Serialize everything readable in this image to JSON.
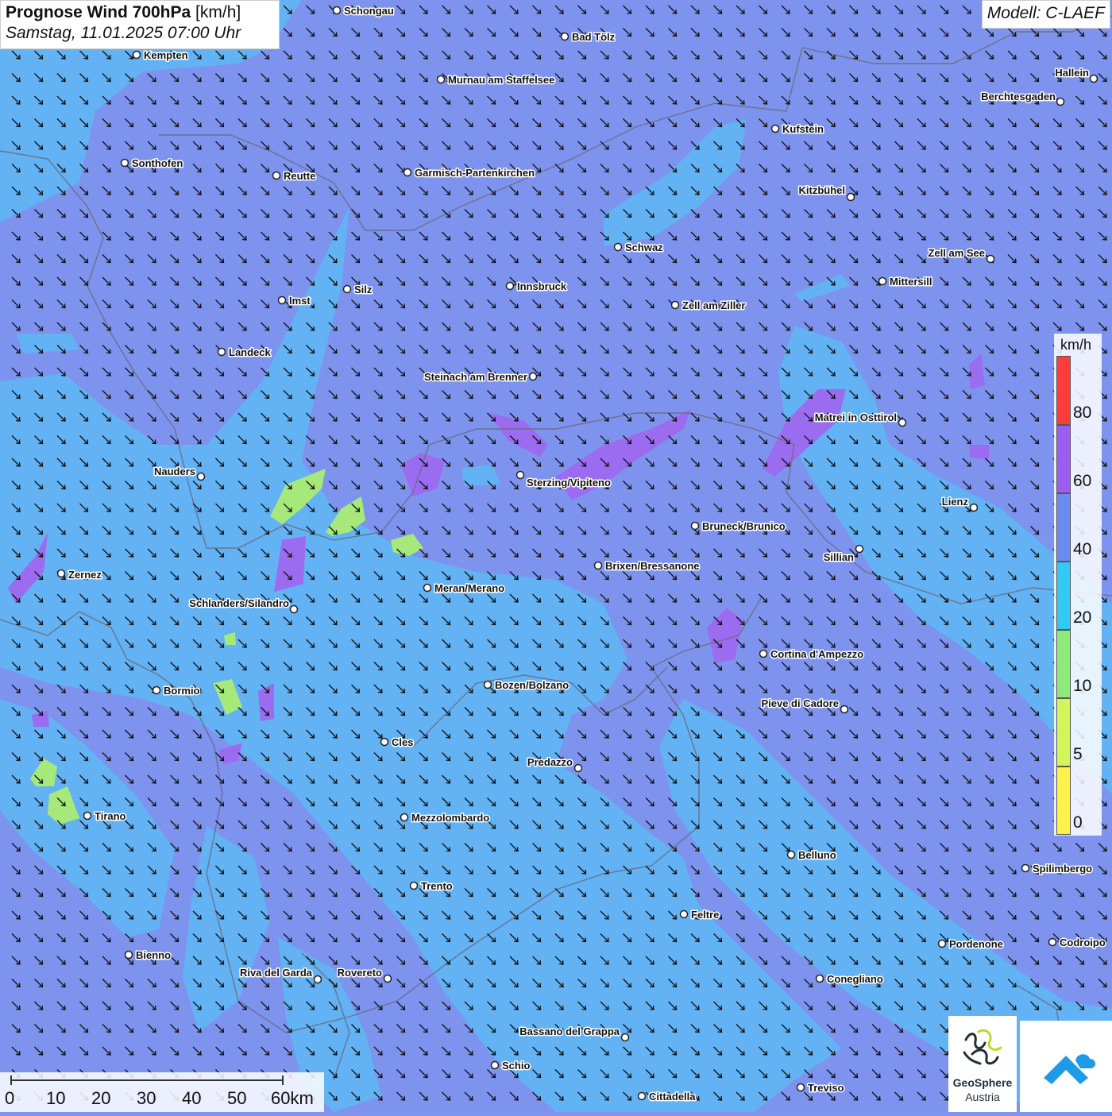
{
  "header": {
    "title_bold": "Prognose Wind 700hPa",
    "title_unit": " [km/h]",
    "datetime": "Samstag, 11.01.2025 07:00 Uhr"
  },
  "model": "Modell: C-LAEF",
  "cities": [
    {
      "name": "Schongau"
    },
    {
      "name": "Bad Tölz"
    },
    {
      "name": "Kempten"
    },
    {
      "name": "Murnau am Staffelsee"
    },
    {
      "name": "Hallein"
    },
    {
      "name": "Berchtesgaden"
    },
    {
      "name": "Kufstein"
    },
    {
      "name": "Sonthofen"
    },
    {
      "name": "Reutte"
    },
    {
      "name": "Garmisch-Partenkirchen"
    },
    {
      "name": "Kitzbühel"
    },
    {
      "name": "Schwaz"
    },
    {
      "name": "Zell am See"
    },
    {
      "name": "Mittersill"
    },
    {
      "name": "Innsbruck"
    },
    {
      "name": "Silz"
    },
    {
      "name": "Imst"
    },
    {
      "name": "Zell am Ziller"
    },
    {
      "name": "Landeck"
    },
    {
      "name": "Steinach am Brenner"
    },
    {
      "name": "Matrei in Osttirol"
    },
    {
      "name": "Nauders"
    },
    {
      "name": "Sterzing/Vipiteno"
    },
    {
      "name": "Lienz"
    },
    {
      "name": "Bruneck/Brunico"
    },
    {
      "name": "Sillian"
    },
    {
      "name": "Zernez"
    },
    {
      "name": "Brixen/Bressanone"
    },
    {
      "name": "Meran/Merano"
    },
    {
      "name": "Schlanders/Silandro"
    },
    {
      "name": "Cortina d'Ampezzo"
    },
    {
      "name": "Bozen/Bolzano"
    },
    {
      "name": "Bormio"
    },
    {
      "name": "Pieve di Cadore"
    },
    {
      "name": "Cles"
    },
    {
      "name": "Predazzo"
    },
    {
      "name": "Tirano"
    },
    {
      "name": "Mezzolombardo"
    },
    {
      "name": "Belluno"
    },
    {
      "name": "Spilimbergo"
    },
    {
      "name": "Trento"
    },
    {
      "name": "Feltre"
    },
    {
      "name": "Bienno"
    },
    {
      "name": "Pordenone"
    },
    {
      "name": "Codroipo"
    },
    {
      "name": "Riva del Garda"
    },
    {
      "name": "Rovereto"
    },
    {
      "name": "Conegliano"
    },
    {
      "name": "Bassano del Grappa"
    },
    {
      "name": "Schio"
    },
    {
      "name": "Treviso"
    },
    {
      "name": "Cittadella"
    }
  ],
  "legend": {
    "unit": "km/h",
    "levels": [
      {
        "value": "80",
        "color": "#ff3b3b"
      },
      {
        "value": "60",
        "color": "#9b5cf0"
      },
      {
        "value": "40",
        "color": "#6a8cf2"
      },
      {
        "value": "20",
        "color": "#33c9f5"
      },
      {
        "value": "10",
        "color": "#8ee87a"
      },
      {
        "value": "5",
        "color": "#d2f55a"
      },
      {
        "value": "0",
        "color": "#fff04a"
      }
    ]
  },
  "scale_bar": {
    "labels": [
      "0",
      "10",
      "20",
      "30",
      "40",
      "50",
      "60km"
    ]
  },
  "wind": {
    "direction": "NW",
    "typical_speed_range_kmh": "20-40"
  },
  "logos": {
    "geosphere_name": "GeoSphere",
    "geosphere_sub": "Austria",
    "app_icon": "mountain-cloud-icon"
  }
}
